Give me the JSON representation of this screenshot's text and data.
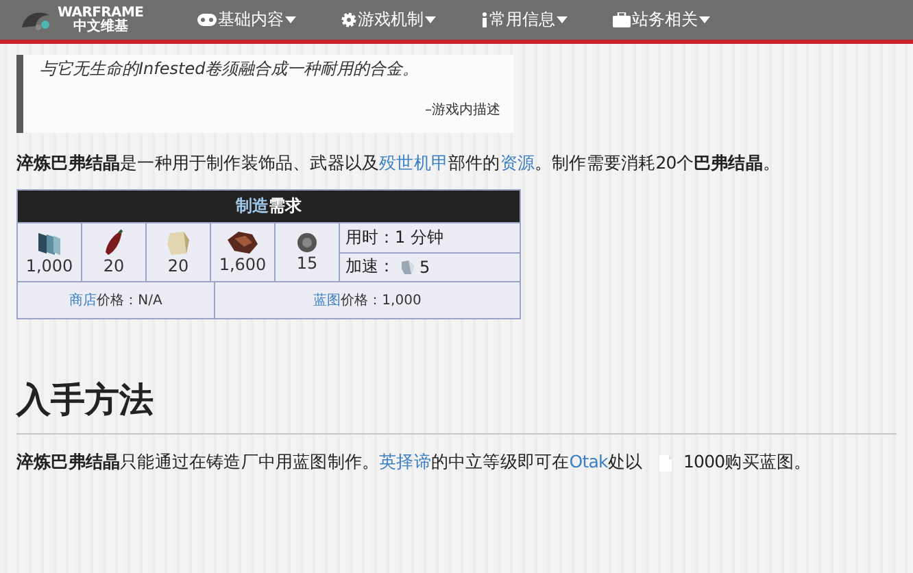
{
  "nav": {
    "logo": {
      "title": "WARFRAME",
      "subtitle": "中文维基"
    },
    "items": [
      {
        "label": "基础内容"
      },
      {
        "label": "游戏机制"
      },
      {
        "label": "常用信息"
      },
      {
        "label": "站务相关"
      }
    ]
  },
  "quote": {
    "text": "与它无生命的Infested卷须融合成一种耐用的合金。",
    "source": "–游戏内描述"
  },
  "intro": [
    {
      "kind": "text",
      "text": "**淬炼巴弗结晶**是一种用于制作装饰品、武器以及"
    },
    {
      "kind": "link",
      "text": "殁世机甲"
    },
    {
      "kind": "text",
      "text": "部件的"
    },
    {
      "kind": "link",
      "text": "资源"
    },
    {
      "kind": "text",
      "text": "。制作需要消耗20个**巴弗结晶**。"
    }
  ],
  "crafting": {
    "title_link": "制造",
    "title_rest": "需求",
    "resources": [
      {
        "amount": "1,000"
      },
      {
        "amount": "20"
      },
      {
        "amount": "20"
      },
      {
        "amount": "1,600"
      },
      {
        "amount": "15"
      }
    ],
    "time": "用时：1 分钟",
    "rush_label": "加速：",
    "rush_amount": "5",
    "market_link": "商店",
    "market_rest": "价格：N/A",
    "blueprint_link": "蓝图",
    "blueprint_rest": "价格：1,000"
  },
  "heading": "入手方法",
  "acquisition": [
    {
      "kind": "text",
      "text": "**淬炼巴弗结晶**只能通过在铸造厂中用蓝图制作。"
    },
    {
      "kind": "link",
      "text": "英择谛"
    },
    {
      "kind": "text",
      "text": "的中立等级即可在"
    },
    {
      "kind": "link",
      "text": "Otak"
    },
    {
      "kind": "text",
      "text": "处以"
    },
    {
      "kind": "icon"
    },
    {
      "kind": "text",
      "text": "1000购买蓝图。"
    }
  ]
}
